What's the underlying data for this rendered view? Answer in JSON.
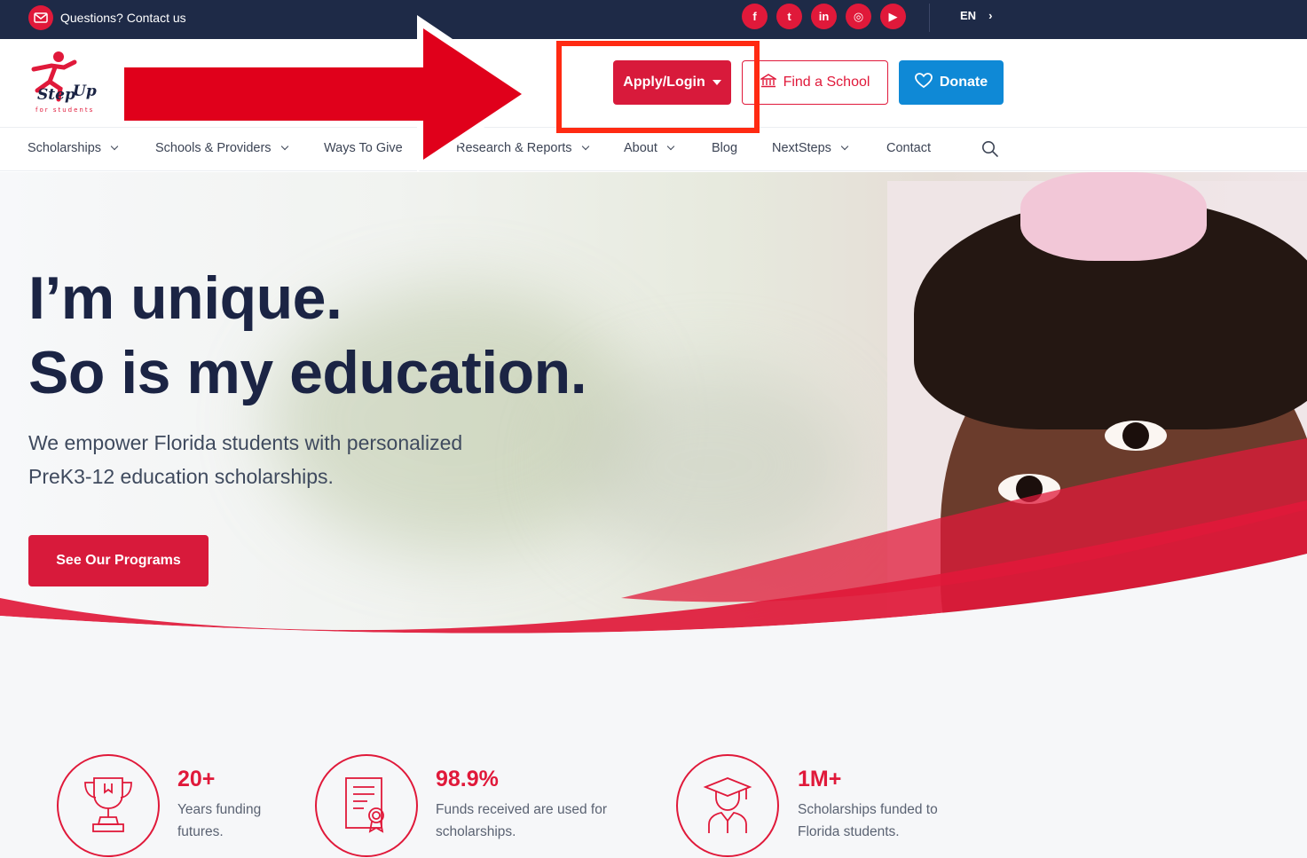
{
  "topbar": {
    "contact_text": "Questions? Contact us",
    "social_icons": [
      "facebook-icon",
      "twitter-icon",
      "linkedin-icon",
      "instagram-icon",
      "youtube-icon"
    ],
    "social_glyphs": [
      "f",
      "t",
      "in",
      "◎",
      "▶"
    ],
    "language": "EN",
    "language_arrow": "›"
  },
  "header": {
    "logo_name": "Step Up for students",
    "apply_label": "Apply/Login",
    "find_label": "Find a School",
    "donate_label": "Donate"
  },
  "nav": {
    "items": [
      {
        "label": "Scholarships",
        "dropdown": true
      },
      {
        "label": "Schools & Providers",
        "dropdown": true
      },
      {
        "label": "Ways To Give",
        "dropdown": false
      },
      {
        "label": "Research & Reports",
        "dropdown": true
      },
      {
        "label": "About",
        "dropdown": true
      },
      {
        "label": "Blog",
        "dropdown": false
      },
      {
        "label": "NextSteps",
        "dropdown": true
      },
      {
        "label": "Contact",
        "dropdown": false
      }
    ]
  },
  "hero": {
    "title_line1": "I’m unique.",
    "title_line2": "So is my education.",
    "subtitle_line1": "We empower Florida students with personalized",
    "subtitle_line2": "PreK3-12 education scholarships.",
    "cta_label": "See Our Programs"
  },
  "stats": [
    {
      "icon": "trophy-icon",
      "value": "20+",
      "line1": "Years funding",
      "line2": "futures."
    },
    {
      "icon": "certificate-icon",
      "value": "98.9%",
      "line1": "Funds received are used for",
      "line2": "scholarships."
    },
    {
      "icon": "graduate-icon",
      "value": "1M+",
      "line1": "Scholarships funded to",
      "line2": "Florida students."
    }
  ],
  "colors": {
    "brand_red": "#d81a3b",
    "navy": "#1e2a47",
    "donate_blue": "#0f89d6",
    "annotation_arrow": "#e0001b",
    "annotation_box": "#ff2a12"
  }
}
